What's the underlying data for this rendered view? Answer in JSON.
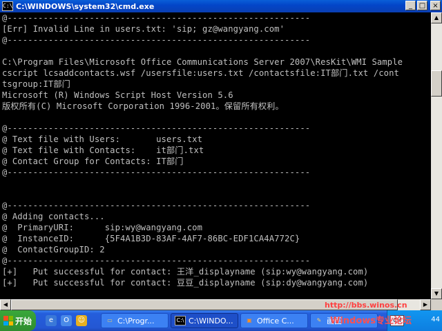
{
  "window": {
    "title": "C:\\WINDOWS\\system32\\cmd.exe",
    "icon_text": "C:\\",
    "buttons": {
      "minimize": "_",
      "maximize": "□",
      "close": "×"
    }
  },
  "console": {
    "lines": [
      "@-----------------------------------------------------------",
      "[Err] Invalid Line in users.txt: 'sip; gz@wangyang.com'",
      "@-----------------------------------------------------------",
      "",
      "C:\\Program Files\\Microsoft Office Communications Server 2007\\ResKit\\WMI Sample",
      "cscript lcsaddcontacts.wsf /usersfile:users.txt /contactsfile:IT部门.txt /cont",
      "tsgroup:IT部门",
      "Microsoft (R) Windows Script Host Version 5.6",
      "版权所有(C) Microsoft Corporation 1996-2001。保留所有权利。",
      "",
      "@-----------------------------------------------------------",
      "@ Text file with Users:       users.txt",
      "@ Text file with Contacts:    it部门.txt",
      "@ Contact Group for Contacts: IT部门",
      "@-----------------------------------------------------------",
      "",
      "",
      "@-----------------------------------------------------------",
      "@ Adding contacts...",
      "@  PrimaryURI:      sip:wy@wangyang.com",
      "@  InstanceID:      {5F4A1B3D-83AF-4AF7-86BC-EDF1CA4A772C}",
      "@  ContactGroupID: 2",
      "@-----------------------------------------------------------",
      "[+]   Put successful for contact: 王洋_displayname (sip:wy@wangyang.com)",
      "[+]   Put successful for contact: 豆豆_displayname (sip:dy@wangyang.com)"
    ]
  },
  "taskbar": {
    "start_label": "开始",
    "quick_launch": [
      {
        "name": "ie-icon",
        "glyph": "e",
        "color": "#3a78d8"
      },
      {
        "name": "outlook-icon",
        "glyph": "O",
        "color": "#4a8ae8"
      },
      {
        "name": "messenger-icon",
        "glyph": "☺",
        "color": "#e8b020"
      }
    ],
    "tasks": [
      {
        "label": "C:\\Progr...",
        "icon": "folder-icon",
        "glyph": "▭",
        "active": false
      },
      {
        "label": "C:\\WINDO...",
        "icon": "cmd-icon",
        "glyph": "C:\\",
        "active": true
      },
      {
        "label": "Office C...",
        "icon": "office-icon",
        "glyph": "▣",
        "active": false
      },
      {
        "label": "画图",
        "icon": "paint-icon",
        "glyph": "✎",
        "active": false
      }
    ],
    "ime_label": "CH",
    "clock": "44"
  },
  "watermark": {
    "line1": "http://bbs.winos.cn",
    "line2": "Windows专业论坛"
  }
}
